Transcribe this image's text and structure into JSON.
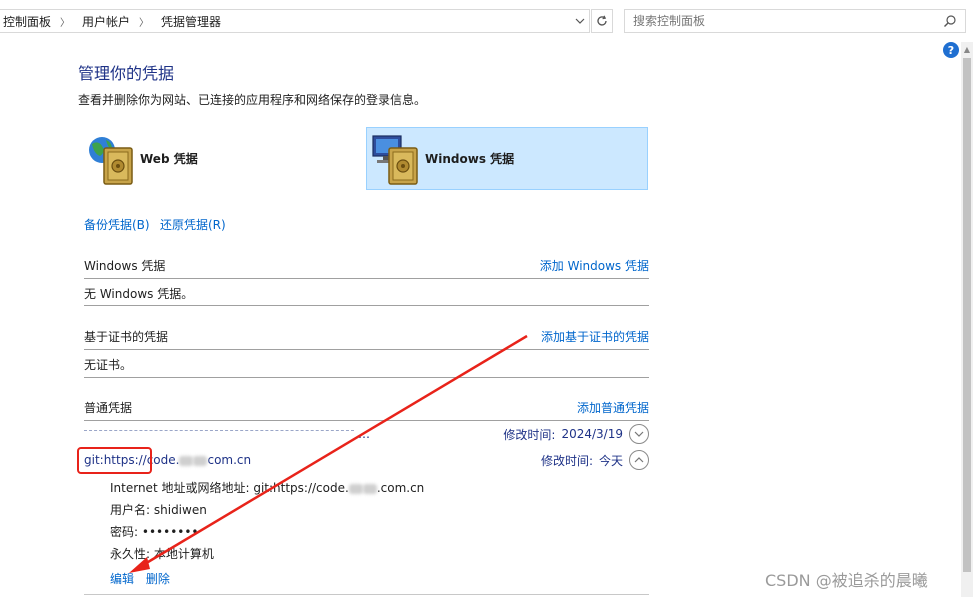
{
  "address_bar": {
    "breadcrumbs": [
      "控制面板",
      "用户帐户",
      "凭据管理器"
    ],
    "search_placeholder": "搜索控制面板"
  },
  "page": {
    "title": "管理你的凭据",
    "description": "查看并删除你为网站、已连接的应用程序和网络保存的登录信息。"
  },
  "tiles": {
    "web_label": "Web 凭据",
    "windows_label": "Windows 凭据",
    "selected": "windows"
  },
  "links": {
    "backup": "备份凭据(B)",
    "restore": "还原凭据(R)"
  },
  "sections": {
    "windows": {
      "title": "Windows 凭据",
      "add_link": "添加 Windows 凭据",
      "empty_text": "无 Windows 凭据。"
    },
    "certificate": {
      "title": "基于证书的凭据",
      "add_link": "添加基于证书的凭据",
      "empty_text": "无证书。"
    },
    "generic": {
      "title": "普通凭据",
      "add_link": "添加普通凭据",
      "items": [
        {
          "name": "…",
          "modified_label": "修改时间:",
          "modified_value": "2024/3/19",
          "expanded": false
        },
        {
          "name_prefix": "git:https://code.",
          "name_suffix": "com.cn",
          "modified_label": "修改时间:",
          "modified_value": "今天",
          "expanded": true
        }
      ]
    }
  },
  "details": {
    "address_label": "Internet 地址或网络地址:",
    "address_prefix": "git:https://code.",
    "address_suffix": ".com.cn",
    "username_label": "用户名:",
    "username_value": "shidiwen",
    "password_label": "密码:",
    "password_value": "••••••••",
    "persistence_label": "永久性:",
    "persistence_value": "本地计算机",
    "edit_link": "编辑",
    "delete_link": "删除"
  },
  "help": "?",
  "watermark": "CSDN @被追杀的晨曦",
  "colors": {
    "link": "#0066cc",
    "title": "#1e3287",
    "selected_tile_bg": "#cce8ff",
    "annotation_red": "#e8231a"
  }
}
